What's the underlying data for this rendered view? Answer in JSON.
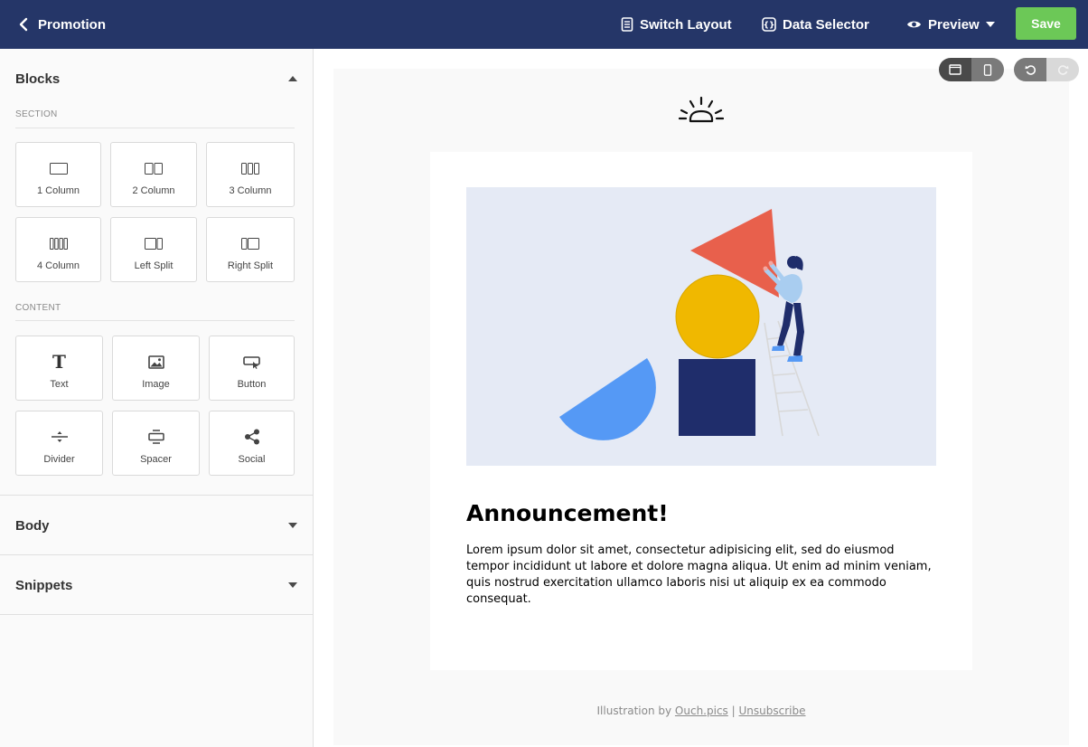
{
  "header": {
    "back_label": "Promotion",
    "switch_layout": "Switch Layout",
    "data_selector": "Data Selector",
    "preview": "Preview",
    "save": "Save"
  },
  "sidebar": {
    "blocks_title": "Blocks",
    "section_label": "SECTION",
    "section_tiles": [
      "1 Column",
      "2 Column",
      "3 Column",
      "4 Column",
      "Left Split",
      "Right Split"
    ],
    "content_label": "CONTENT",
    "content_tiles": [
      "Text",
      "Image",
      "Button",
      "Divider",
      "Spacer",
      "Social"
    ],
    "body_title": "Body",
    "snippets_title": "Snippets"
  },
  "email": {
    "heading": "Announcement!",
    "body": "Lorem ipsum dolor sit amet, consectetur adipisicing elit, sed do eiusmod tempor incididunt ut labore et dolore magna aliqua. Ut enim ad minim veniam, quis nostrud exercitation ullamco laboris nisi ut aliquip ex ea commodo consequat.",
    "footer_prefix": "Illustration by",
    "footer_link": "Ouch.pics",
    "footer_sep": "|",
    "unsubscribe": "Unsubscribe"
  },
  "colors": {
    "header_bg": "#253668",
    "save_bg": "#6cc857",
    "hero_bg": "#e5eaf5",
    "triangle": "#e8604c",
    "circle": "#f0b800",
    "square": "#1f2d6b",
    "half_circle": "#5599f5"
  }
}
